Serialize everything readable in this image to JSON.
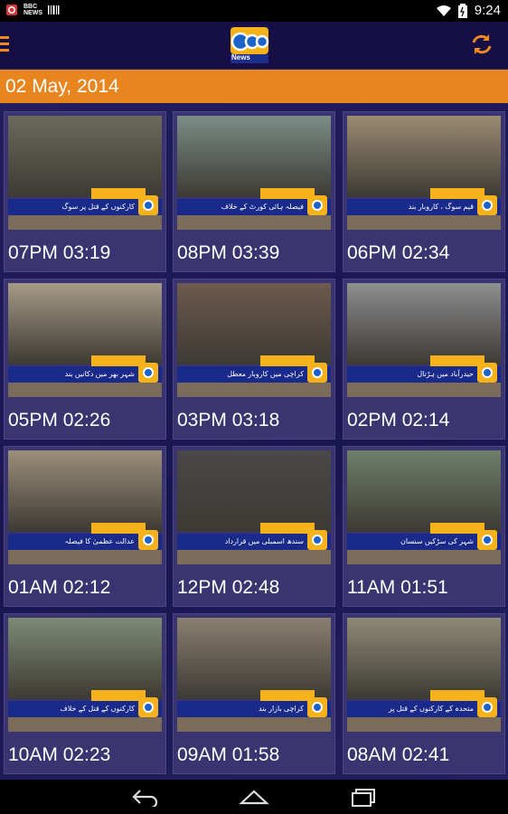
{
  "status_bar": {
    "left_icons": [
      "app-notification-icon",
      "bbc-news-icon",
      "barcode-icon"
    ],
    "bbc_text": "BBC NEWS",
    "time": "9:24"
  },
  "app_bar": {
    "logo_text": "News",
    "menu_icon": "menu-icon",
    "refresh_icon": "refresh-icon"
  },
  "date_header": "02 May, 2014",
  "bulletins": [
    {
      "label": "07PM 03:19",
      "ticker": "کارکنوں کے قتل پر سوگ",
      "scene": "#6b6a5c"
    },
    {
      "label": "08PM 03:39",
      "ticker": "فیصلہ ہائی کورٹ کے خلاف",
      "scene": "#7b8c86"
    },
    {
      "label": "06PM 02:34",
      "ticker": "قیم سوگ ، کاروبار بند",
      "scene": "#9a8a72"
    },
    {
      "label": "05PM 02:26",
      "ticker": "شہر بھر میں دکانیں بند",
      "scene": "#a59a86"
    },
    {
      "label": "03PM 03:18",
      "ticker": "کراچی میں کاروبار معطل",
      "scene": "#6d5a4e"
    },
    {
      "label": "02PM 02:14",
      "ticker": "حیدرآباد میں ہڑتال",
      "scene": "#8d8e90"
    },
    {
      "label": "01AM 02:12",
      "ticker": "عدالت عظمیٰ کا فیصلہ",
      "scene": "#9c8f7a"
    },
    {
      "label": "12PM 02:48",
      "ticker": "سندھ اسمبلی میں قرارداد",
      "scene": "#4a4848"
    },
    {
      "label": "11AM 01:51",
      "ticker": "شہر کی سڑکیں سنسان",
      "scene": "#6f7f6a"
    },
    {
      "label": "10AM 02:23",
      "ticker": "کارکنوں کے قتل کے خلاف",
      "scene": "#7d8a74"
    },
    {
      "label": "09AM 01:58",
      "ticker": "کراچی بازار بند",
      "scene": "#8a7f70"
    },
    {
      "label": "08AM 02:41",
      "ticker": "متحدہ کے کارکنوں کے قتل پر",
      "scene": "#8f8a76"
    }
  ],
  "colors": {
    "accent_orange": "#e8851e",
    "app_bar": "#150f45",
    "background": "#1b1850",
    "ticker_blue": "#1a2a8a",
    "ticker_yellow": "#f5b21b"
  },
  "nav": {
    "back_icon": "back-icon",
    "home_icon": "home-icon",
    "recents_icon": "recents-icon"
  }
}
